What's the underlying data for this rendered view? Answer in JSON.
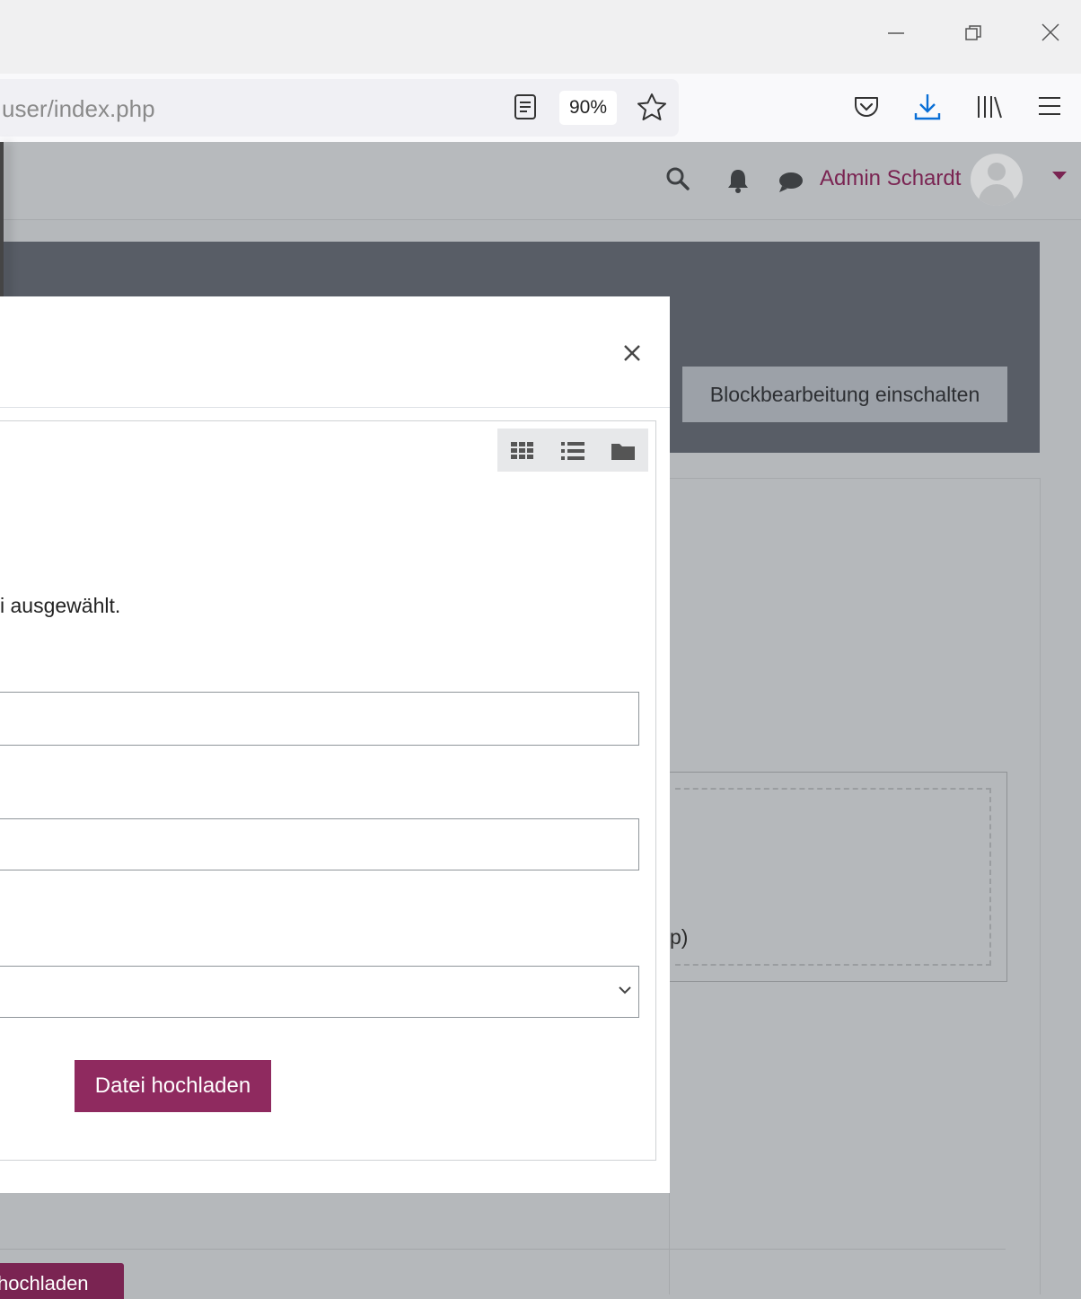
{
  "browser": {
    "url_text": "user/index.php",
    "zoom_label": "90%",
    "window_controls": [
      "minimize",
      "restore",
      "close"
    ]
  },
  "navbar": {
    "user_name": "Admin Schardt",
    "icons": [
      "search-icon",
      "bell-icon",
      "chat-icon"
    ]
  },
  "page": {
    "block_edit_button": "Blockbearbeitung einschalten",
    "dropzone_text": "p)",
    "upload_button_partial": "hochladen"
  },
  "modal": {
    "selected_text": "i ausgewählt.",
    "upload_button": "Datei hochladen",
    "view_modes": [
      "grid-icon",
      "list-icon",
      "folder-icon"
    ]
  }
}
